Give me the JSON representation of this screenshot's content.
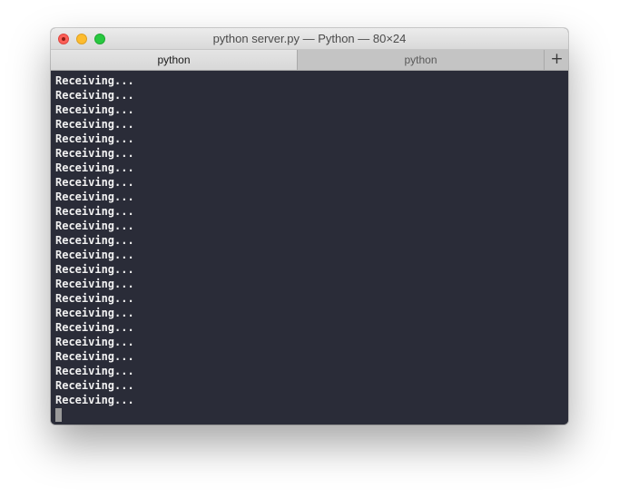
{
  "window": {
    "title": "python server.py — Python — 80×24"
  },
  "tabs": [
    {
      "label": "python",
      "active": true
    },
    {
      "label": "python",
      "active": false
    }
  ],
  "new_tab_label": "+",
  "terminal": {
    "lines": [
      "Receiving...",
      "Receiving...",
      "Receiving...",
      "Receiving...",
      "Receiving...",
      "Receiving...",
      "Receiving...",
      "Receiving...",
      "Receiving...",
      "Receiving...",
      "Receiving...",
      "Receiving...",
      "Receiving...",
      "Receiving...",
      "Receiving...",
      "Receiving...",
      "Receiving...",
      "Receiving...",
      "Receiving...",
      "Receiving...",
      "Receiving...",
      "Receiving...",
      "Receiving..."
    ]
  },
  "colors": {
    "terminal_bg": "#2a2c38",
    "terminal_fg": "#f2f2f2",
    "close": "#fc5f57",
    "minimize": "#fdbc2e",
    "zoom": "#28c840"
  }
}
